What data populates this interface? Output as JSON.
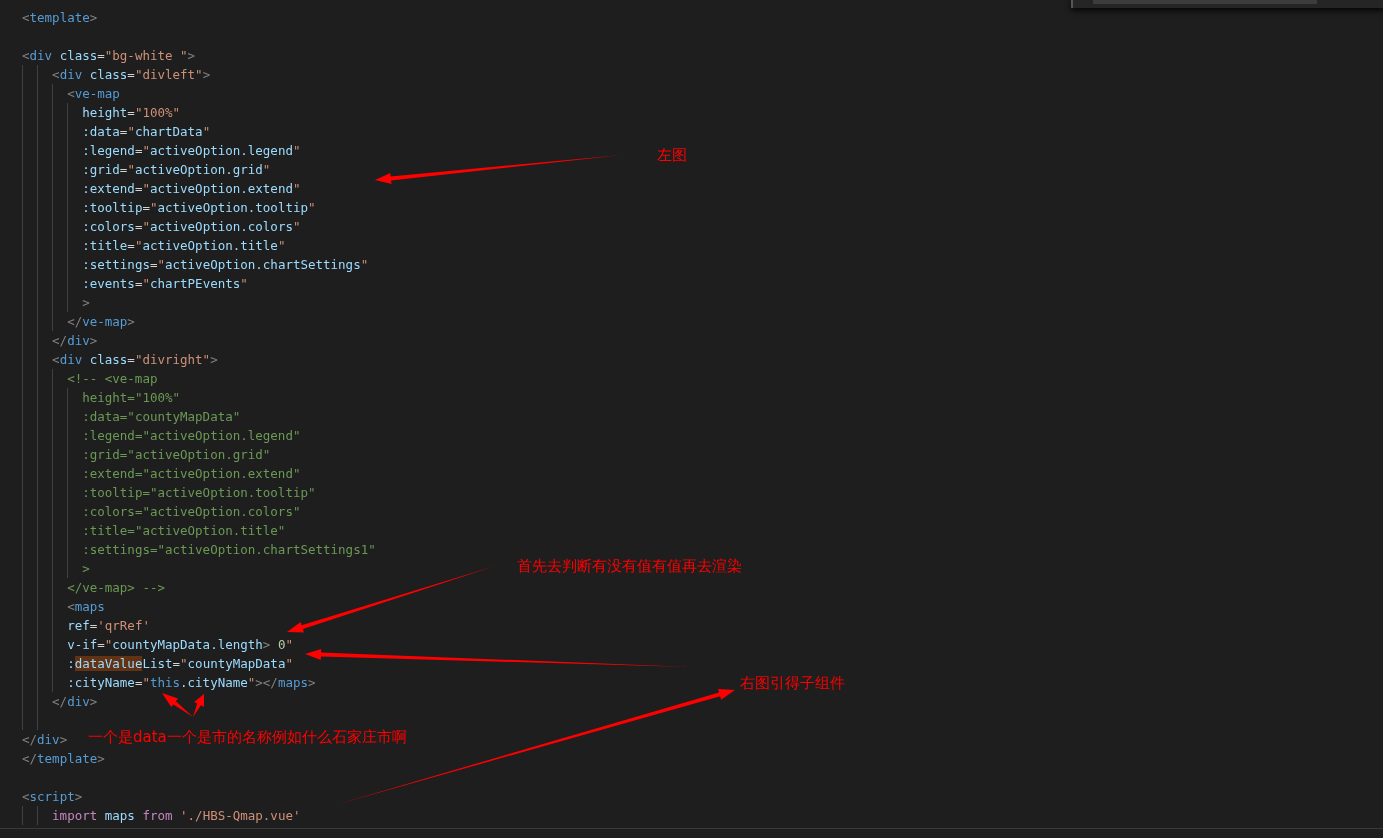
{
  "editor": {
    "lines": [
      {
        "kind": "code",
        "tokens": [
          {
            "kind": "punct",
            "text": "<"
          },
          {
            "kind": "tag",
            "text": "template"
          },
          {
            "kind": "punct",
            "text": ">"
          }
        ]
      },
      {
        "kind": "blank"
      },
      {
        "kind": "code",
        "tokens": [
          {
            "kind": "punct",
            "text": "<"
          },
          {
            "kind": "tag",
            "text": "div"
          },
          {
            "kind": "attr",
            "text": " class"
          },
          {
            "kind": "eq",
            "text": "="
          },
          {
            "kind": "str",
            "text": "\"bg-white \""
          },
          {
            "kind": "punct",
            "text": ">"
          }
        ],
        "children": [
          {
            "kind": "code",
            "tokens": [
              {
                "kind": "punct",
                "text": "<"
              },
              {
                "kind": "tag",
                "text": "div"
              },
              {
                "kind": "attr",
                "text": " class"
              },
              {
                "kind": "eq",
                "text": "="
              },
              {
                "kind": "str",
                "text": "\"divleft\""
              },
              {
                "kind": "punct",
                "text": ">"
              }
            ],
            "children": [
              {
                "kind": "code",
                "tokens": [
                  {
                    "kind": "punct",
                    "text": "<"
                  },
                  {
                    "kind": "tag",
                    "text": "ve-map"
                  }
                ],
                "children": [
                  {
                    "kind": "code",
                    "tokens": [
                      {
                        "kind": "attr",
                        "text": "height"
                      },
                      {
                        "kind": "eq",
                        "text": "="
                      },
                      {
                        "kind": "str",
                        "text": "\"100%\""
                      }
                    ]
                  },
                  {
                    "kind": "code",
                    "tokens": [
                      {
                        "kind": "attr",
                        "text": ":data"
                      },
                      {
                        "kind": "eq",
                        "text": "="
                      },
                      {
                        "kind": "str",
                        "text": "\""
                      },
                      {
                        "kind": "expr",
                        "text": "chartData"
                      },
                      {
                        "kind": "str",
                        "text": "\""
                      }
                    ]
                  },
                  {
                    "kind": "code",
                    "tokens": [
                      {
                        "kind": "attr",
                        "text": ":legend"
                      },
                      {
                        "kind": "eq",
                        "text": "="
                      },
                      {
                        "kind": "str",
                        "text": "\""
                      },
                      {
                        "kind": "expr",
                        "text": "activeOption.legend"
                      },
                      {
                        "kind": "str",
                        "text": "\""
                      }
                    ]
                  },
                  {
                    "kind": "code",
                    "tokens": [
                      {
                        "kind": "attr",
                        "text": ":grid"
                      },
                      {
                        "kind": "eq",
                        "text": "="
                      },
                      {
                        "kind": "str",
                        "text": "\""
                      },
                      {
                        "kind": "expr",
                        "text": "activeOption.grid"
                      },
                      {
                        "kind": "str",
                        "text": "\""
                      }
                    ]
                  },
                  {
                    "kind": "code",
                    "tokens": [
                      {
                        "kind": "attr",
                        "text": ":extend"
                      },
                      {
                        "kind": "eq",
                        "text": "="
                      },
                      {
                        "kind": "str",
                        "text": "\""
                      },
                      {
                        "kind": "expr",
                        "text": "activeOption.extend"
                      },
                      {
                        "kind": "str",
                        "text": "\""
                      }
                    ]
                  },
                  {
                    "kind": "code",
                    "tokens": [
                      {
                        "kind": "attr",
                        "text": ":tooltip"
                      },
                      {
                        "kind": "eq",
                        "text": "="
                      },
                      {
                        "kind": "str",
                        "text": "\""
                      },
                      {
                        "kind": "expr",
                        "text": "activeOption.tooltip"
                      },
                      {
                        "kind": "str",
                        "text": "\""
                      }
                    ]
                  },
                  {
                    "kind": "code",
                    "tokens": [
                      {
                        "kind": "attr",
                        "text": ":colors"
                      },
                      {
                        "kind": "eq",
                        "text": "="
                      },
                      {
                        "kind": "str",
                        "text": "\""
                      },
                      {
                        "kind": "expr",
                        "text": "activeOption.colors"
                      },
                      {
                        "kind": "str",
                        "text": "\""
                      }
                    ]
                  },
                  {
                    "kind": "code",
                    "tokens": [
                      {
                        "kind": "attr",
                        "text": ":title"
                      },
                      {
                        "kind": "eq",
                        "text": "="
                      },
                      {
                        "kind": "str",
                        "text": "\""
                      },
                      {
                        "kind": "expr",
                        "text": "activeOption.title"
                      },
                      {
                        "kind": "str",
                        "text": "\""
                      }
                    ]
                  },
                  {
                    "kind": "code",
                    "tokens": [
                      {
                        "kind": "attr",
                        "text": ":settings"
                      },
                      {
                        "kind": "eq",
                        "text": "="
                      },
                      {
                        "kind": "str",
                        "text": "\""
                      },
                      {
                        "kind": "expr",
                        "text": "activeOption.chartSettings"
                      },
                      {
                        "kind": "str",
                        "text": "\""
                      }
                    ]
                  },
                  {
                    "kind": "code",
                    "tokens": [
                      {
                        "kind": "attr",
                        "text": ":events"
                      },
                      {
                        "kind": "eq",
                        "text": "="
                      },
                      {
                        "kind": "str",
                        "text": "\""
                      },
                      {
                        "kind": "expr",
                        "text": "chartPEvents"
                      },
                      {
                        "kind": "str",
                        "text": "\""
                      }
                    ]
                  },
                  {
                    "kind": "code",
                    "tokens": [
                      {
                        "kind": "punct",
                        "text": ">"
                      }
                    ]
                  }
                ]
              },
              {
                "kind": "code",
                "tokens": [
                  {
                    "kind": "punct",
                    "text": "</"
                  },
                  {
                    "kind": "tag",
                    "text": "ve-map"
                  },
                  {
                    "kind": "punct",
                    "text": ">"
                  }
                ]
              }
            ]
          },
          {
            "kind": "code",
            "tokens": [
              {
                "kind": "punct",
                "text": "</"
              },
              {
                "kind": "tag",
                "text": "div"
              },
              {
                "kind": "punct",
                "text": ">"
              }
            ]
          },
          {
            "kind": "code",
            "tokens": [
              {
                "kind": "punct",
                "text": "<"
              },
              {
                "kind": "tag",
                "text": "div"
              },
              {
                "kind": "attr",
                "text": " class"
              },
              {
                "kind": "eq",
                "text": "="
              },
              {
                "kind": "str",
                "text": "\"divright\""
              },
              {
                "kind": "punct",
                "text": ">"
              }
            ],
            "children": [
              {
                "kind": "code",
                "tokens": [
                  {
                    "kind": "comment",
                    "text": "<!-- <ve-map"
                  }
                ],
                "children": [
                  {
                    "kind": "code",
                    "tokens": [
                      {
                        "kind": "comment",
                        "text": "height=\"100%\""
                      }
                    ]
                  },
                  {
                    "kind": "code",
                    "tokens": [
                      {
                        "kind": "comment",
                        "text": ":data=\"countyMapData\""
                      }
                    ]
                  },
                  {
                    "kind": "code",
                    "tokens": [
                      {
                        "kind": "comment",
                        "text": ":legend=\"activeOption.legend\""
                      }
                    ]
                  },
                  {
                    "kind": "code",
                    "tokens": [
                      {
                        "kind": "comment",
                        "text": ":grid=\"activeOption.grid\""
                      }
                    ]
                  },
                  {
                    "kind": "code",
                    "tokens": [
                      {
                        "kind": "comment",
                        "text": ":extend=\"activeOption.extend\""
                      }
                    ]
                  },
                  {
                    "kind": "code",
                    "tokens": [
                      {
                        "kind": "comment",
                        "text": ":tooltip=\"activeOption.tooltip\""
                      }
                    ]
                  },
                  {
                    "kind": "code",
                    "tokens": [
                      {
                        "kind": "comment",
                        "text": ":colors=\"activeOption.colors\""
                      }
                    ]
                  },
                  {
                    "kind": "code",
                    "tokens": [
                      {
                        "kind": "comment",
                        "text": ":title=\"activeOption.title\""
                      }
                    ]
                  },
                  {
                    "kind": "code",
                    "tokens": [
                      {
                        "kind": "comment",
                        "text": ":settings=\"activeOption.chartSettings1\""
                      }
                    ]
                  },
                  {
                    "kind": "code",
                    "tokens": [
                      {
                        "kind": "comment",
                        "text": ">"
                      }
                    ]
                  }
                ]
              },
              {
                "kind": "code",
                "tokens": [
                  {
                    "kind": "comment",
                    "text": "</ve-map> -->"
                  }
                ]
              },
              {
                "kind": "code",
                "tokens": [
                  {
                    "kind": "punct",
                    "text": "<"
                  },
                  {
                    "kind": "tag",
                    "text": "maps"
                  }
                ]
              },
              {
                "kind": "code",
                "tokens": [
                  {
                    "kind": "attr",
                    "text": "ref"
                  },
                  {
                    "kind": "eq",
                    "text": "="
                  },
                  {
                    "kind": "str",
                    "text": "'qrRef'"
                  }
                ]
              },
              {
                "kind": "code",
                "tokens": [
                  {
                    "kind": "attr",
                    "text": "v-if"
                  },
                  {
                    "kind": "eq",
                    "text": "="
                  },
                  {
                    "kind": "str",
                    "text": "\""
                  },
                  {
                    "kind": "expr",
                    "text": "countyMapData.length"
                  },
                  {
                    "kind": "punct",
                    "text": ">"
                  },
                  {
                    "kind": "num",
                    "text": " 0"
                  },
                  {
                    "kind": "str",
                    "text": "\""
                  }
                ]
              },
              {
                "kind": "code",
                "tokens": [
                  {
                    "kind": "attr",
                    "text": ":"
                  },
                  {
                    "kind": "highlight",
                    "text": "dataValue"
                  },
                  {
                    "kind": "attr",
                    "text": "List"
                  },
                  {
                    "kind": "eq",
                    "text": "="
                  },
                  {
                    "kind": "str",
                    "text": "\""
                  },
                  {
                    "kind": "expr",
                    "text": "countyMapData"
                  },
                  {
                    "kind": "str",
                    "text": "\""
                  }
                ]
              },
              {
                "kind": "code",
                "tokens": [
                  {
                    "kind": "attr",
                    "text": ":cityName"
                  },
                  {
                    "kind": "eq",
                    "text": "="
                  },
                  {
                    "kind": "str",
                    "text": "\""
                  },
                  {
                    "kind": "keyword",
                    "text": "this"
                  },
                  {
                    "kind": "expr",
                    "text": ".cityName"
                  },
                  {
                    "kind": "str",
                    "text": "\""
                  },
                  {
                    "kind": "punct",
                    "text": "></"
                  },
                  {
                    "kind": "tag",
                    "text": "maps"
                  },
                  {
                    "kind": "punct",
                    "text": ">"
                  }
                ]
              }
            ]
          },
          {
            "kind": "code",
            "tokens": [
              {
                "kind": "punct",
                "text": "</"
              },
              {
                "kind": "tag",
                "text": "div"
              },
              {
                "kind": "punct",
                "text": ">"
              }
            ]
          },
          {
            "kind": "blank"
          }
        ]
      },
      {
        "kind": "code",
        "tokens": [
          {
            "kind": "punct",
            "text": "</"
          },
          {
            "kind": "tag",
            "text": "div"
          },
          {
            "kind": "punct",
            "text": ">"
          }
        ]
      },
      {
        "kind": "code",
        "tokens": [
          {
            "kind": "punct",
            "text": "</"
          },
          {
            "kind": "tag",
            "text": "template"
          },
          {
            "kind": "punct",
            "text": ">"
          }
        ]
      },
      {
        "kind": "blank"
      },
      {
        "kind": "code",
        "tokens": [
          {
            "kind": "punct",
            "text": "<"
          },
          {
            "kind": "tag",
            "text": "script"
          },
          {
            "kind": "punct",
            "text": ">"
          }
        ],
        "children": [
          {
            "kind": "code",
            "tokens": [
              {
                "kind": "control",
                "text": "import"
              },
              {
                "kind": "expr",
                "text": " maps"
              },
              {
                "kind": "control",
                "text": " from"
              },
              {
                "kind": "str",
                "text": " './HBS-Qmap.vue'"
              }
            ]
          }
        ]
      }
    ]
  },
  "annotations": [
    {
      "text": "左图"
    },
    {
      "text": "首先去判断有没有值有值再去渲染"
    },
    {
      "text": "一个是data一个是市的名称例如什么石家庄市啊"
    },
    {
      "text": "右图引得子组件"
    }
  ]
}
